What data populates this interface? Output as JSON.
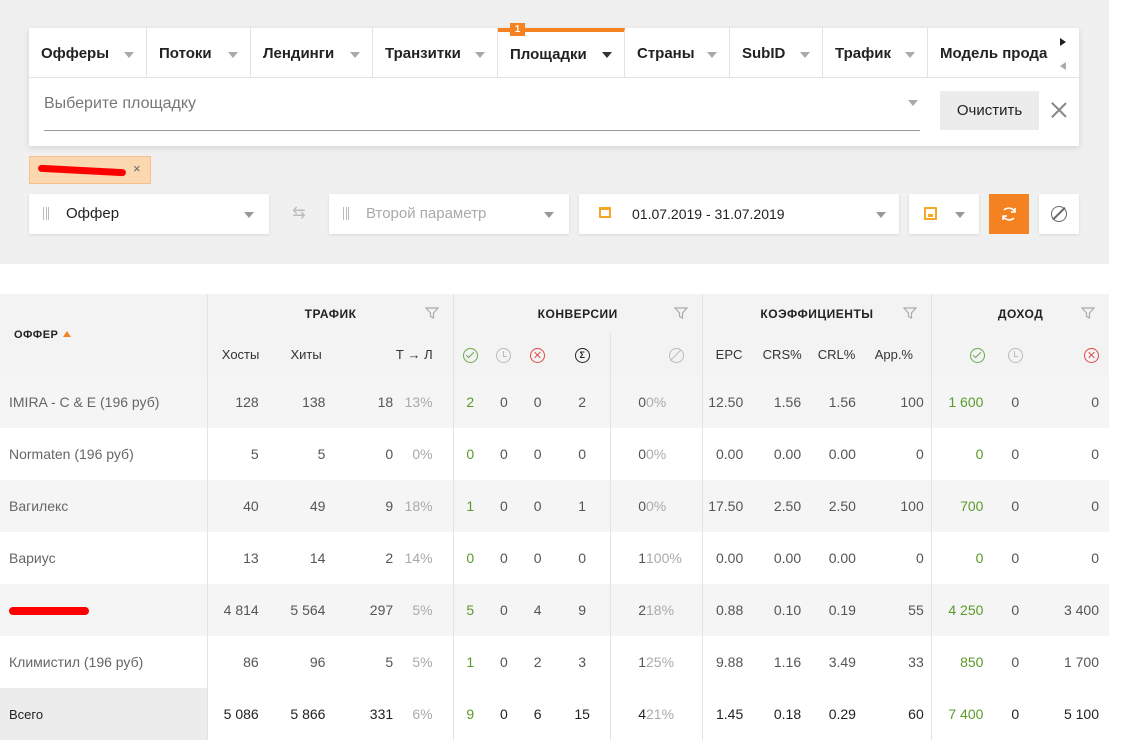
{
  "tabs": [
    {
      "label": "Офферы"
    },
    {
      "label": "Потоки"
    },
    {
      "label": "Лендинги"
    },
    {
      "label": "Транзитки"
    },
    {
      "label": "Площадки",
      "badge": "1",
      "active": true
    },
    {
      "label": "Страны"
    },
    {
      "label": "SubID"
    },
    {
      "label": "Трафик"
    },
    {
      "label": "Модель прода"
    }
  ],
  "filter": {
    "placeholder": "Выберите площадку",
    "clear_label": "Очистить"
  },
  "chip": {
    "remove": "×"
  },
  "controls": {
    "param1": "Оффер",
    "swap_icon": "⇆",
    "param2_placeholder": "Второй параметр",
    "date_range": "01.07.2019 - 31.07.2019"
  },
  "table": {
    "offer_header": "ОФФЕР",
    "groups": {
      "traffic": "ТРАФИК",
      "conversions": "КОНВЕРСИИ",
      "coefficients": "КОЭФФИЦИЕНТЫ",
      "income": "ДОХОД"
    },
    "sub": {
      "hosts": "Хосты",
      "hits": "Хиты",
      "tl": "Т → Л",
      "sum_symbol": "Σ",
      "epc": "EPC",
      "crs": "CRS%",
      "crl": "CRL%",
      "app": "App.%"
    },
    "rows": [
      {
        "name": "IMIRA - С & Е (196 руб)",
        "hosts": "128",
        "hits": "138",
        "tl": "18",
        "tl_pct": "13%",
        "c_ok": "2",
        "c_wait": "0",
        "c_no": "0",
        "c_sum": "2",
        "c_blk": "0",
        "c_blk_pct": "0%",
        "epc": "12.50",
        "crs": "1.56",
        "crl": "1.56",
        "app": "100",
        "i_ok": "1 600",
        "i_wait": "0",
        "i_no": "0"
      },
      {
        "name": "Normaten (196 руб)",
        "hosts": "5",
        "hits": "5",
        "tl": "0",
        "tl_pct": "0%",
        "c_ok": "0",
        "c_wait": "0",
        "c_no": "0",
        "c_sum": "0",
        "c_blk": "0",
        "c_blk_pct": "0%",
        "epc": "0.00",
        "crs": "0.00",
        "crl": "0.00",
        "app": "0",
        "i_ok": "0",
        "i_wait": "0",
        "i_no": "0"
      },
      {
        "name": "Вагилекс",
        "hosts": "40",
        "hits": "49",
        "tl": "9",
        "tl_pct": "18%",
        "c_ok": "1",
        "c_wait": "0",
        "c_no": "0",
        "c_sum": "1",
        "c_blk": "0",
        "c_blk_pct": "0%",
        "epc": "17.50",
        "crs": "2.50",
        "crl": "2.50",
        "app": "100",
        "i_ok": "700",
        "i_wait": "0",
        "i_no": "0"
      },
      {
        "name": "Вариус",
        "hosts": "13",
        "hits": "14",
        "tl": "2",
        "tl_pct": "14%",
        "c_ok": "0",
        "c_wait": "0",
        "c_no": "0",
        "c_sum": "0",
        "c_blk": "1",
        "c_blk_pct": "100%",
        "epc": "0.00",
        "crs": "0.00",
        "crl": "0.00",
        "app": "0",
        "i_ok": "0",
        "i_wait": "0",
        "i_no": "0"
      },
      {
        "name": "",
        "redacted": true,
        "hosts": "4 814",
        "hits": "5 564",
        "tl": "297",
        "tl_pct": "5%",
        "c_ok": "5",
        "c_wait": "0",
        "c_no": "4",
        "c_sum": "9",
        "c_blk": "2",
        "c_blk_pct": "18%",
        "epc": "0.88",
        "crs": "0.10",
        "crl": "0.19",
        "app": "55",
        "i_ok": "4 250",
        "i_wait": "0",
        "i_no": "3 400"
      },
      {
        "name": "Климистил (196 руб)",
        "hosts": "86",
        "hits": "96",
        "tl": "5",
        "tl_pct": "5%",
        "c_ok": "1",
        "c_wait": "0",
        "c_no": "2",
        "c_sum": "3",
        "c_blk": "1",
        "c_blk_pct": "25%",
        "epc": "9.88",
        "crs": "1.16",
        "crl": "3.49",
        "app": "33",
        "i_ok": "850",
        "i_wait": "0",
        "i_no": "1 700"
      },
      {
        "name": "Всего",
        "total": true,
        "hosts": "5 086",
        "hits": "5 866",
        "tl": "331",
        "tl_pct": "6%",
        "c_ok": "9",
        "c_wait": "0",
        "c_no": "6",
        "c_sum": "15",
        "c_blk": "4",
        "c_blk_pct": "21%",
        "epc": "1.45",
        "crs": "0.18",
        "crl": "0.29",
        "app": "60",
        "i_ok": "7 400",
        "i_wait": "0",
        "i_no": "5 100"
      }
    ]
  },
  "colors": {
    "accent": "#f58220",
    "green": "#5a9a2b",
    "red": "#e04848"
  }
}
